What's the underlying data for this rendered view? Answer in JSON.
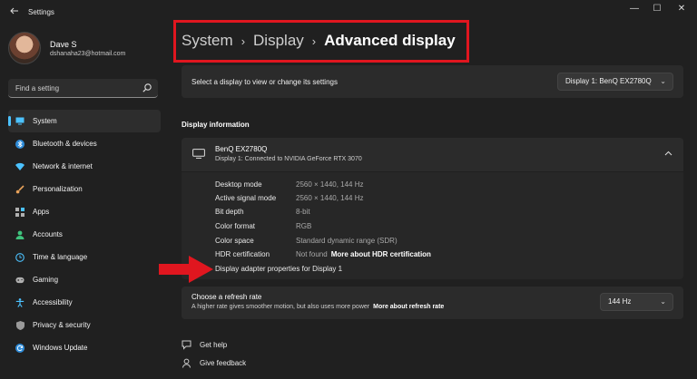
{
  "window": {
    "title": "Settings",
    "controls": [
      "—",
      "☐",
      "✕"
    ]
  },
  "profile": {
    "name": "Dave S",
    "email": "dshanaha23@hotmail.com"
  },
  "search": {
    "placeholder": "Find a setting"
  },
  "nav": {
    "items": [
      {
        "label": "System",
        "icon": "monitor-icon",
        "color": "#4cc2ff",
        "active": true
      },
      {
        "label": "Bluetooth & devices",
        "icon": "bluetooth-icon",
        "color": "#4cc2ff"
      },
      {
        "label": "Network & internet",
        "icon": "wifi-icon",
        "color": "#4cc2ff"
      },
      {
        "label": "Personalization",
        "icon": "brush-icon",
        "color": "#e8a25a"
      },
      {
        "label": "Apps",
        "icon": "apps-icon",
        "color": "#b0b0b0"
      },
      {
        "label": "Accounts",
        "icon": "person-icon",
        "color": "#3fc37d"
      },
      {
        "label": "Time & language",
        "icon": "globe-clock-icon",
        "color": "#4cc2ff"
      },
      {
        "label": "Gaming",
        "icon": "gamepad-icon",
        "color": "#b0b0b0"
      },
      {
        "label": "Accessibility",
        "icon": "accessibility-icon",
        "color": "#4cc2ff"
      },
      {
        "label": "Privacy & security",
        "icon": "shield-icon",
        "color": "#9a9a9a"
      },
      {
        "label": "Windows Update",
        "icon": "update-icon",
        "color": "#4cc2ff"
      }
    ]
  },
  "breadcrumb": {
    "items": [
      "System",
      "Display",
      "Advanced display"
    ],
    "separator": "›"
  },
  "select_display": {
    "label": "Select a display to view or change its settings",
    "selected": "Display 1: BenQ EX2780Q"
  },
  "display_info": {
    "heading": "Display information",
    "monitor_name": "BenQ EX2780Q",
    "monitor_sub": "Display 1: Connected to NVIDIA GeForce RTX 3070",
    "rows": [
      {
        "key": "Desktop mode",
        "value": "2560 × 1440, 144 Hz"
      },
      {
        "key": "Active signal mode",
        "value": "2560 × 1440, 144 Hz"
      },
      {
        "key": "Bit depth",
        "value": "8-bit"
      },
      {
        "key": "Color format",
        "value": "RGB"
      },
      {
        "key": "Color space",
        "value": "Standard dynamic range (SDR)"
      },
      {
        "key": "HDR certification",
        "value": "Not found",
        "link": "More about HDR certification"
      }
    ],
    "adapter_link": "Display adapter properties for Display 1"
  },
  "refresh": {
    "title": "Choose a refresh rate",
    "desc": "A higher rate gives smoother motion, but also uses more power",
    "link": "More about refresh rate",
    "selected": "144 Hz"
  },
  "footer": {
    "help": "Get help",
    "feedback": "Give feedback"
  },
  "colors": {
    "accent": "#4cc2ff",
    "highlight_box": "#e0161f",
    "arrow": "#e0161f"
  }
}
